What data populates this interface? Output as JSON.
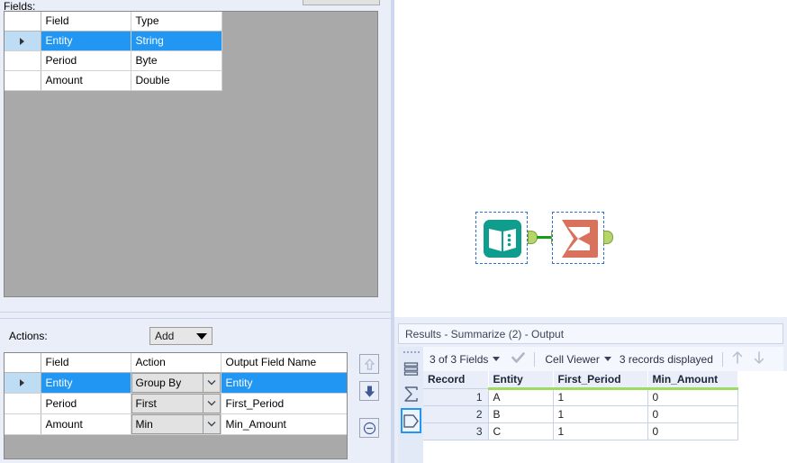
{
  "config": {
    "fields_label": "Fields:",
    "actions_label": "Actions:",
    "add_button_label": "Add",
    "fields_grid": {
      "columns": [
        "",
        "Field",
        "Type"
      ],
      "rows": [
        {
          "marker": true,
          "field": "Entity",
          "type": "String",
          "selected": true
        },
        {
          "marker": false,
          "field": "Period",
          "type": "Byte",
          "selected": false
        },
        {
          "marker": false,
          "field": "Amount",
          "type": "Double",
          "selected": false
        }
      ]
    },
    "actions_grid": {
      "columns": [
        "",
        "Field",
        "Action",
        "Output Field Name"
      ],
      "rows": [
        {
          "marker": true,
          "field": "Entity",
          "action": "Group By",
          "output": "Entity",
          "selected": true
        },
        {
          "marker": false,
          "field": "Period",
          "action": "First",
          "output": "First_Period",
          "selected": false
        },
        {
          "marker": false,
          "field": "Amount",
          "action": "Min",
          "output": "Min_Amount",
          "selected": false
        }
      ]
    },
    "side_buttons": [
      {
        "name": "move-up-button",
        "icon": "arrow-up-icon",
        "enabled": false
      },
      {
        "name": "move-down-button",
        "icon": "arrow-down-icon",
        "enabled": true
      },
      {
        "name": "remove-row-button",
        "icon": "minus-circle-icon",
        "enabled": true
      }
    ]
  },
  "canvas": {
    "tools": [
      {
        "name": "input-data-tool",
        "icon": "book-icon",
        "color": "#0f9e8e"
      },
      {
        "name": "summarize-tool",
        "icon": "sigma-icon",
        "color": "#d9725c"
      }
    ],
    "connection_color": "#12a012"
  },
  "results": {
    "title": "Results - Summarize (2) - Output",
    "toolbar": {
      "fields_selector": "3 of 3 Fields",
      "checkmark_icon": "check-icon",
      "viewer_selector": "Cell Viewer",
      "records_displayed": "3 records displayed",
      "prev_icon": "arrow-up-icon",
      "next_icon": "arrow-down-icon"
    },
    "rail": [
      {
        "name": "results-data-view",
        "icon": "list-rows-icon"
      },
      {
        "name": "results-messages-view",
        "icon": "sigma-icon"
      },
      {
        "name": "results-metadata-view",
        "icon": "tag-icon",
        "active": true
      }
    ],
    "table": {
      "columns": [
        "Record",
        "Entity",
        "First_Period",
        "Min_Amount"
      ],
      "rows": [
        [
          "1",
          "A",
          "1",
          "0"
        ],
        [
          "2",
          "B",
          "1",
          "0"
        ],
        [
          "3",
          "C",
          "1",
          "0"
        ]
      ]
    },
    "header_underline_color": "#9ddb63"
  }
}
